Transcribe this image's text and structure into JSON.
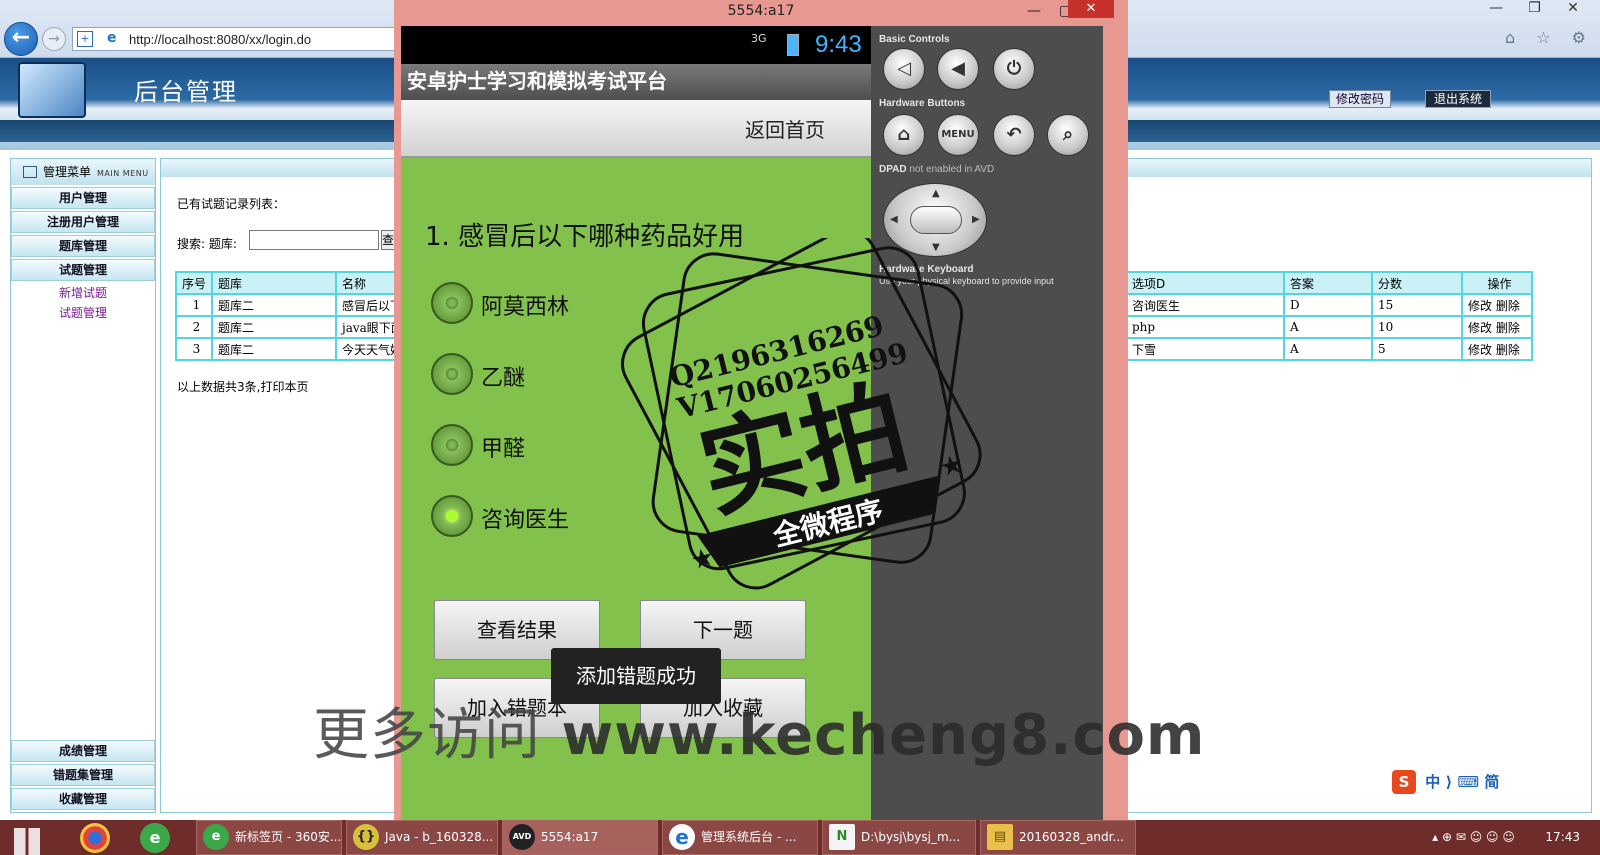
{
  "browser": {
    "url": "http://localhost:8080/xx/login.do",
    "window_controls": [
      "—",
      "❐",
      "✕"
    ],
    "nav_icons": [
      "⌂",
      "☆",
      "⚙"
    ]
  },
  "admin": {
    "title": "后台管理",
    "change_password": "修改密码",
    "logout": "退出系统"
  },
  "sidebar": {
    "heading": "管理菜单",
    "heading_sub": "MAIN MENU",
    "top_items": [
      "用户管理",
      "注册用户管理",
      "题库管理",
      "试题管理"
    ],
    "sub_items": [
      "新增试题",
      "试题管理"
    ],
    "bottom_items": [
      "成绩管理",
      "错题集管理",
      "收藏管理"
    ]
  },
  "main": {
    "list_caption": "已有试题记录列表：",
    "search_label": "搜索:  题库:",
    "search_button": "查",
    "summary": "以上数据共3条,打印本页",
    "table": {
      "headers": [
        "序号",
        "题库",
        "名称",
        "选项D",
        "答案",
        "分数",
        "操作"
      ],
      "rows": [
        [
          "1",
          "题库二",
          "感冒后以下",
          "咨询医生",
          "D",
          "15",
          "修改  删除"
        ],
        [
          "2",
          "题库二",
          "java眼下面",
          "php",
          "A",
          "10",
          "修改  删除"
        ],
        [
          "3",
          "题库二",
          "今天天气好",
          "下雪",
          "A",
          "5",
          "修改  删除"
        ]
      ]
    }
  },
  "emulator": {
    "window_title": "5554:a17",
    "close_label": "✕",
    "status": {
      "network": "3G",
      "time": "9:43"
    },
    "app_title": "安卓护士学习和模拟考试平台",
    "home_button": "返回首页",
    "question": "1. 感冒后以下哪种药品好用",
    "options": [
      "阿莫西林",
      "乙醚",
      "甲醛",
      "咨询医生"
    ],
    "selected_option_index": 3,
    "buttons": {
      "view_result": "查看结果",
      "next": "下一题",
      "add_wrong": "加入错题本",
      "add_favorite": "加入收藏"
    },
    "toast": "添加错题成功",
    "controls": {
      "basic_label": "Basic Controls",
      "hardware_label": "Hardware Buttons",
      "dpad_label": "DPAD",
      "dpad_note": "not enabled in AVD",
      "keyboard_label": "Hardware Keyboard",
      "keyboard_note": "Use your physical keyboard to provide input",
      "menu_label": "MENU",
      "basic_icons": [
        "volume-down-icon",
        "volume-up-icon",
        "power-icon"
      ],
      "hardware_icons": [
        "home-icon",
        "menu-icon",
        "back-icon",
        "search-icon"
      ]
    }
  },
  "watermark": {
    "stamp_line1": "Q2196316269",
    "stamp_line2": "V17060256499",
    "stamp_big": "实拍",
    "stamp_ribbon": "全微程序",
    "site_prefix": "更多访问",
    "site_url": "www.kecheng8.com"
  },
  "ime": {
    "logo": "S",
    "text": "中 ⟩ ⌨ 简"
  },
  "taskbar": {
    "items": [
      {
        "label": "新标签页 - 360安...",
        "icon": "e"
      },
      {
        "label": "Java - b_160328...",
        "icon": "{}"
      },
      {
        "label": "5554:a17",
        "icon": "AVD"
      },
      {
        "label": "管理系统后台 - ...",
        "icon": "e"
      },
      {
        "label": "D:\\bysj\\bysj_m...",
        "icon": "N"
      },
      {
        "label": "20160328_andr...",
        "icon": "▤"
      }
    ],
    "clock": "17:43"
  },
  "colors": {
    "emulator_frame": "#e79891",
    "phone_bg": "#83c14d",
    "table_border": "#53d6e2",
    "taskbar": "#6e2d2a"
  }
}
